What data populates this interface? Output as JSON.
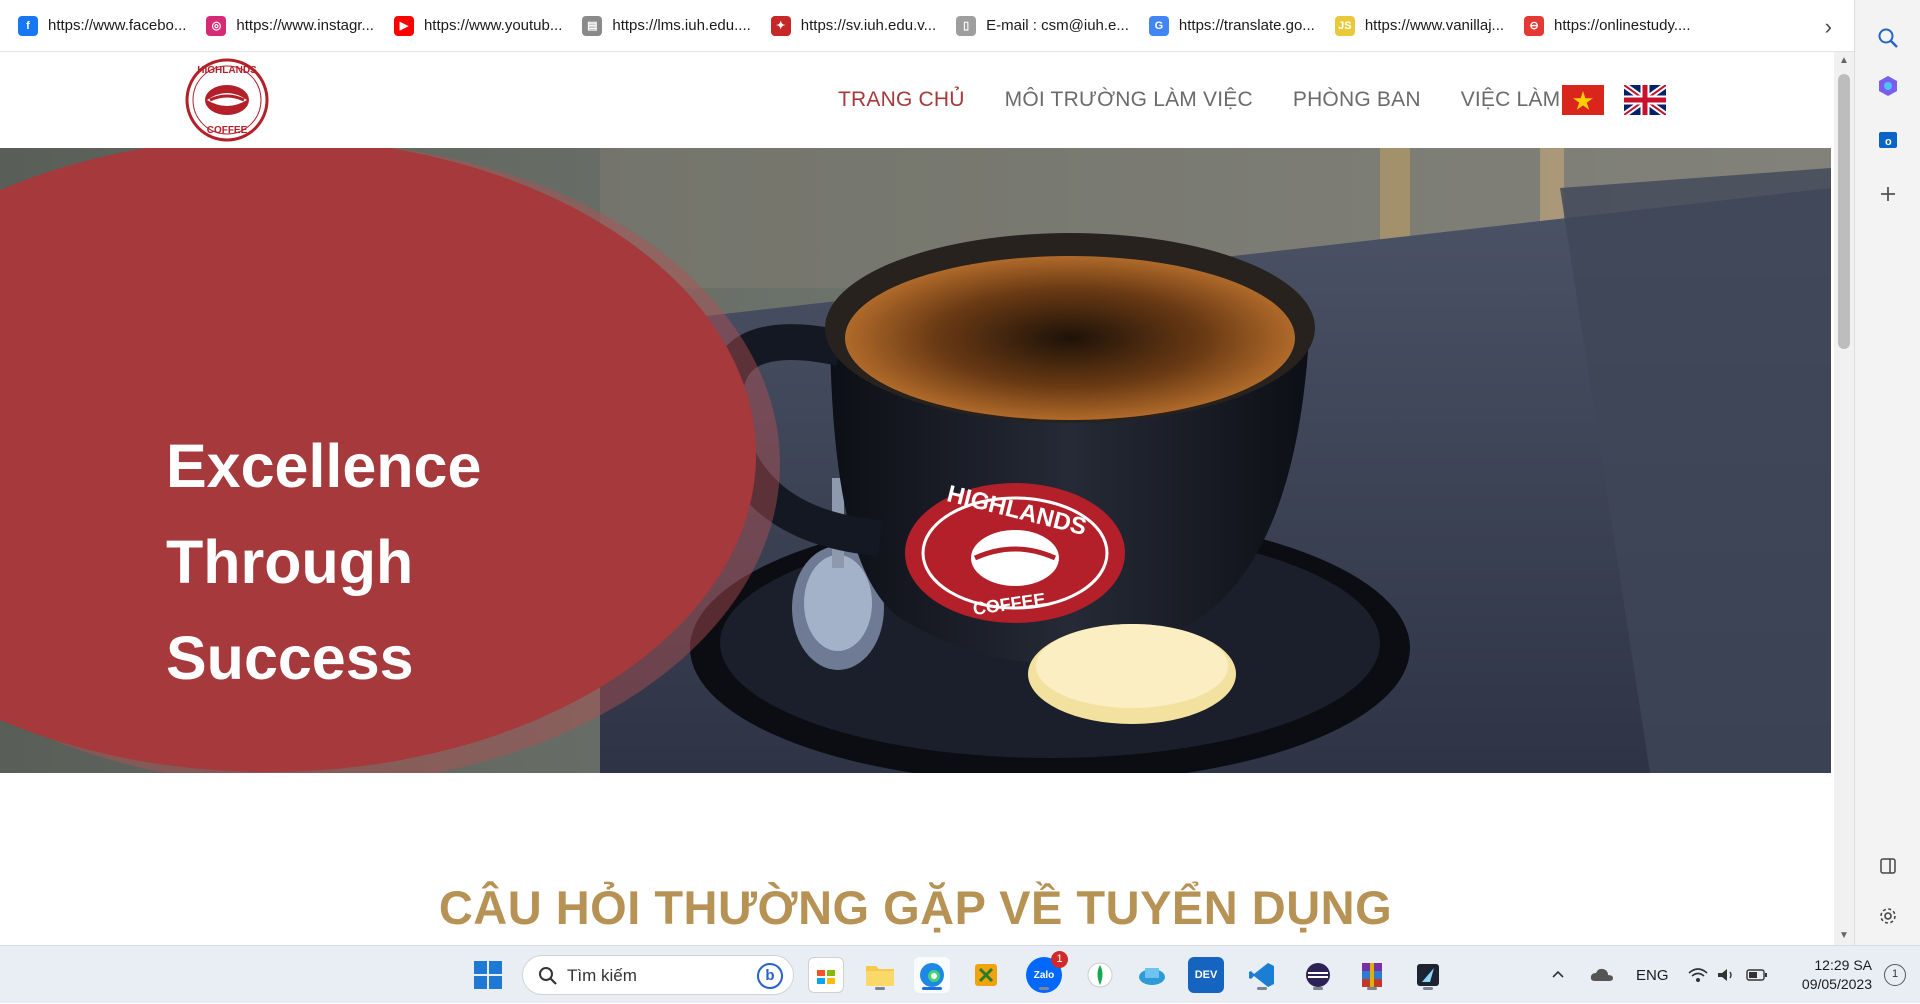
{
  "bookmarks": [
    {
      "label": "https://www.facebo...",
      "icon": "facebook-icon",
      "color": "#1877f2",
      "glyph": "f"
    },
    {
      "label": "https://www.instagr...",
      "icon": "instagram-icon",
      "color": "#d62976",
      "glyph": "◎"
    },
    {
      "label": "https://www.youtub...",
      "icon": "youtube-icon",
      "color": "#ff0000",
      "glyph": "▶"
    },
    {
      "label": "https://lms.iuh.edu....",
      "icon": "lms-icon",
      "color": "#8a8a8a",
      "glyph": "▤"
    },
    {
      "label": "https://sv.iuh.edu.v...",
      "icon": "iuh-icon",
      "color": "#c62828",
      "glyph": "✦"
    },
    {
      "label": "E-mail : csm@iuh.e...",
      "icon": "page-icon",
      "color": "#9e9e9e",
      "glyph": "▯"
    },
    {
      "label": "https://translate.go...",
      "icon": "translate-icon",
      "color": "#4285f4",
      "glyph": "G"
    },
    {
      "label": "https://www.vanillaj...",
      "icon": "js-icon",
      "color": "#e9c93a",
      "glyph": "JS"
    },
    {
      "label": "https://onlinestudy....",
      "icon": "onlinestudy-icon",
      "color": "#e53935",
      "glyph": "⊖"
    }
  ],
  "nav": {
    "home": "TRANG CHỦ",
    "environment": "MÔI TRƯỜNG LÀM VIỆC",
    "departments": "PHÒNG BAN",
    "jobs": "VIỆC LÀM"
  },
  "logo": {
    "top": "HIGHLANDS",
    "bottom": "COFFEE"
  },
  "hero": {
    "line1": "Excellence",
    "line2": "Through",
    "line3": "Success",
    "mug_text_top": "HIGHLANDS",
    "mug_text_bottom": "COFFEE"
  },
  "faq_title": "CÂU HỎI THƯỜNG GẶP VỀ TUYỂN DỤNG",
  "colors": {
    "brand_red": "#a5393b",
    "gold": "#b79255"
  },
  "taskbar": {
    "search_placeholder": "Tìm kiếm",
    "zalo_badge": "1",
    "language": "ENG",
    "time": "12:29 SA",
    "date": "09/05/2023",
    "notif_count": "1"
  }
}
